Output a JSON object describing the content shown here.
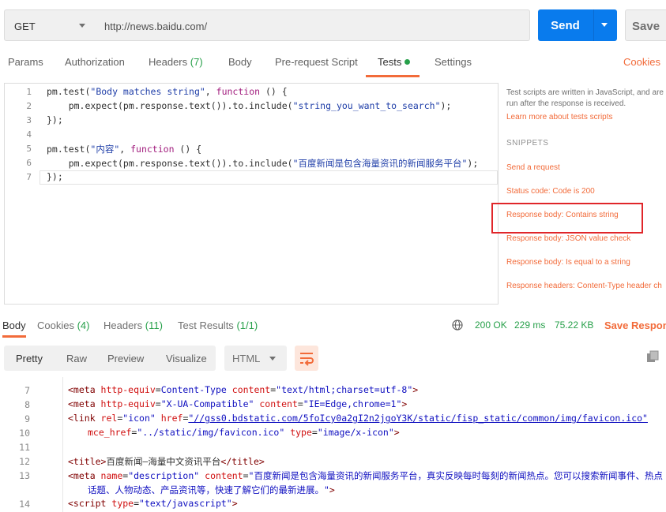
{
  "request": {
    "method": "GET",
    "url": "http://news.baidu.com/",
    "send_label": "Send",
    "save_label": "Save"
  },
  "request_tabs": [
    {
      "label": "Params"
    },
    {
      "label": "Authorization"
    },
    {
      "label": "Headers",
      "count": "(7)"
    },
    {
      "label": "Body"
    },
    {
      "label": "Pre-request Script"
    },
    {
      "label": "Tests"
    },
    {
      "label": "Settings"
    }
  ],
  "cookies_label": "Cookies",
  "editor": {
    "line_numbers": [
      "1",
      "2",
      "3",
      "4",
      "5",
      "6",
      "7"
    ],
    "lines": [
      {
        "pre": "pm.test(",
        "str": "\"Body matches string\"",
        "mid": ", ",
        "kw": "function",
        "post": " () {"
      },
      {
        "pre": "    pm.expect(pm.response.text()).to.include(",
        "str": "\"string_you_want_to_search\"",
        "mid": ");",
        "kw": "",
        "post": ""
      },
      {
        "pre": "});",
        "str": "",
        "mid": "",
        "kw": "",
        "post": ""
      },
      {
        "pre": "",
        "str": "",
        "mid": "",
        "kw": "",
        "post": ""
      },
      {
        "pre": "pm.test(",
        "str": "\"内容\"",
        "mid": ", ",
        "kw": "function",
        "post": " () {"
      },
      {
        "pre": "    pm.expect(pm.response.text()).to.include(",
        "str": "\"百度新闻是包含海量资讯的新闻服务平台\"",
        "mid": ");",
        "kw": "",
        "post": ""
      },
      {
        "pre": "});",
        "str": "",
        "mid": "",
        "kw": "",
        "post": ""
      }
    ]
  },
  "side_panel": {
    "info_line1": "Test scripts are written in JavaScript, and are",
    "info_line2": "run after the response is received.",
    "learn_more": "Learn more about tests scripts",
    "snippets_heading": "SNIPPETS",
    "snippets": [
      "Send a request",
      "Status code: Code is 200",
      "Response body: Contains string",
      "Response body: JSON value check",
      "Response body: Is equal to a string",
      "Response headers: Content-Type header ch"
    ]
  },
  "response_tabs": [
    {
      "label": "Body",
      "count": ""
    },
    {
      "label": "Cookies",
      "count": "(4)"
    },
    {
      "label": "Headers",
      "count": "(11)"
    },
    {
      "label": "Test Results",
      "count": "(1/1)"
    }
  ],
  "response_status": {
    "code": "200 OK",
    "time": "229 ms",
    "size": "75.22 KB",
    "save_response": "Save Respons"
  },
  "format_tabs": [
    "Pretty",
    "Raw",
    "Preview",
    "Visualize"
  ],
  "language": "HTML",
  "response_lines": [
    {
      "n": "7"
    },
    {
      "n": "8"
    },
    {
      "n": "9"
    },
    {
      "n": "10"
    },
    {
      "n": "11"
    },
    {
      "n": "12"
    },
    {
      "n": "13"
    },
    {
      "n": ""
    },
    {
      "n": "14"
    }
  ],
  "response_code": {
    "l7": {
      "tag_open": "<meta ",
      "a1": "http-equiv",
      "v1": "Content-Type",
      "a2": "content",
      "v2": "\"text/html;charset=utf-8\"",
      "tag_close": ">"
    },
    "l8": {
      "tag_open": "<meta ",
      "a1": "http-equiv",
      "v1": "\"X-UA-Compatible\"",
      "a2": "content",
      "v2": "\"IE=Edge,chrome=1\"",
      "tag_close": ">"
    },
    "l9": {
      "tag_open": "<link ",
      "a1": "rel",
      "v1": "\"icon\"",
      "a2": "href",
      "v2": "\"//gss0.bdstatic.com/5foIcy0a2gI2n2jgoY3K/static/fisp_static/common/img/favicon.ico\""
    },
    "l10": {
      "a1": "mce_href",
      "v1": "\"../static/img/favicon.ico\"",
      "a2": "type",
      "v2": "\"image/x-icon\"",
      "tag_close": ">"
    },
    "l12": {
      "tag_open": "<title>",
      "text": "百度新闻—海量中文资讯平台",
      "tag_close": "</title>"
    },
    "l13": {
      "tag_open": "<meta ",
      "a1": "name",
      "v1": "\"description\"",
      "a2": "content",
      "v2": "\"百度新闻是包含海量资讯的新闻服务平台，真实反映每时每刻的新闻热点。您可以搜索新闻事件、热点"
    },
    "l13b": {
      "v2": "话题、人物动态、产品资讯等，快速了解它们的最新进展。\"",
      "tag_close": ">"
    },
    "l14": {
      "tag_open": "<script ",
      "a1": "type",
      "v1": "\"text/javascript\"",
      "tag_close": ">"
    }
  },
  "colors": {
    "accent": "#f26b3a",
    "send": "#097bed",
    "success": "#27a04a",
    "highlight_box": "#e0262a"
  }
}
